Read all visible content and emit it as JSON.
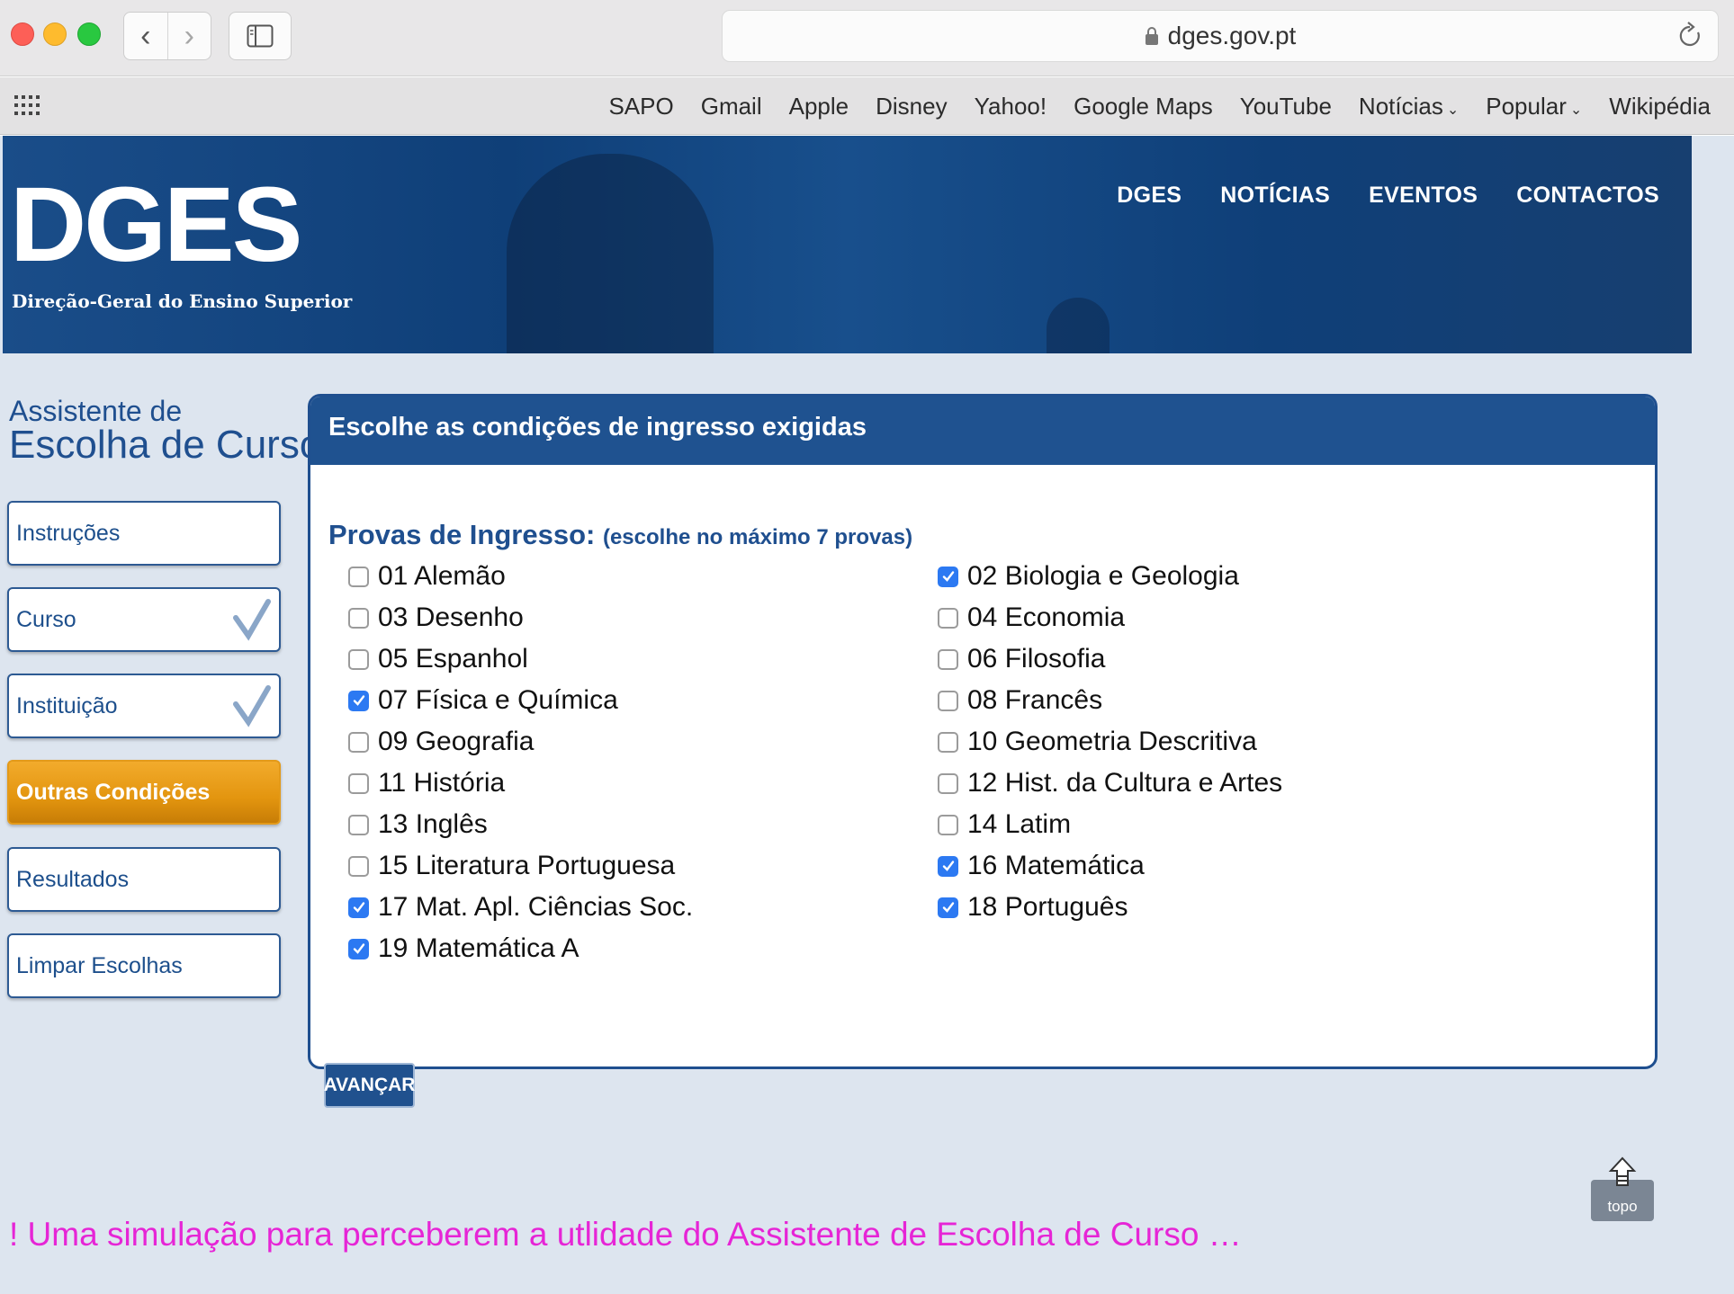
{
  "browser": {
    "nav_back": "‹",
    "nav_forward": "›",
    "url": "dges.gov.pt",
    "bookmarks": [
      {
        "label": "SAPO",
        "has_menu": false
      },
      {
        "label": "Gmail",
        "has_menu": false
      },
      {
        "label": "Apple",
        "has_menu": false
      },
      {
        "label": "Disney",
        "has_menu": false
      },
      {
        "label": "Yahoo!",
        "has_menu": false
      },
      {
        "label": "Google Maps",
        "has_menu": false
      },
      {
        "label": "YouTube",
        "has_menu": false
      },
      {
        "label": "Notícias",
        "has_menu": true
      },
      {
        "label": "Popular",
        "has_menu": true
      },
      {
        "label": "Wikipédia",
        "has_menu": false
      }
    ]
  },
  "header": {
    "logo": "DGES",
    "logo_subtitle": "Direção-Geral do Ensino Superior",
    "nav": [
      "DGES",
      "NOTÍCIAS",
      "EVENTOS",
      "CONTACTOS"
    ]
  },
  "sidebar": {
    "title_line1": "Assistente de",
    "title_line2": "Escolha de Curso",
    "items": [
      {
        "label": "Instruções",
        "checked": false,
        "active": false
      },
      {
        "label": "Curso",
        "checked": true,
        "active": false
      },
      {
        "label": "Instituição",
        "checked": true,
        "active": false
      },
      {
        "label": "Outras Condições",
        "checked": false,
        "active": true
      },
      {
        "label": "Resultados",
        "checked": false,
        "active": false
      },
      {
        "label": "Limpar Escolhas",
        "checked": false,
        "active": false
      }
    ]
  },
  "panel": {
    "title": "Escolhe as condições de ingresso exigidas",
    "provas_label": "Provas de Ingresso:",
    "provas_note": "(escolhe no máximo 7 provas)",
    "options": [
      {
        "label": "01 Alemão",
        "checked": false
      },
      {
        "label": "02 Biologia e Geologia",
        "checked": true
      },
      {
        "label": "03 Desenho",
        "checked": false
      },
      {
        "label": "04 Economia",
        "checked": false
      },
      {
        "label": "05 Espanhol",
        "checked": false
      },
      {
        "label": "06 Filosofia",
        "checked": false
      },
      {
        "label": "07 Física e Química",
        "checked": true
      },
      {
        "label": "08 Francês",
        "checked": false
      },
      {
        "label": "09 Geografia",
        "checked": false
      },
      {
        "label": "10 Geometria Descritiva",
        "checked": false
      },
      {
        "label": "11 História",
        "checked": false
      },
      {
        "label": "12 Hist. da Cultura e Artes",
        "checked": false
      },
      {
        "label": "13 Inglês",
        "checked": false
      },
      {
        "label": "14 Latim",
        "checked": false
      },
      {
        "label": "15 Literatura Portuguesa",
        "checked": false
      },
      {
        "label": "16 Matemática",
        "checked": true
      },
      {
        "label": "17 Mat. Apl. Ciências Soc.",
        "checked": true
      },
      {
        "label": "18 Português",
        "checked": true
      },
      {
        "label": "19 Matemática A",
        "checked": true
      }
    ],
    "submit_label": "AVANÇAR"
  },
  "topo_label": "topo",
  "caption": "! Uma simulação para perceberem a utlidade do Assistente de Escolha de Curso …",
  "colors": {
    "brand_blue": "#1f5290",
    "active_orange": "#e3950f",
    "checkbox_blue": "#2c79f2",
    "caption_magenta": "#e625d6"
  }
}
